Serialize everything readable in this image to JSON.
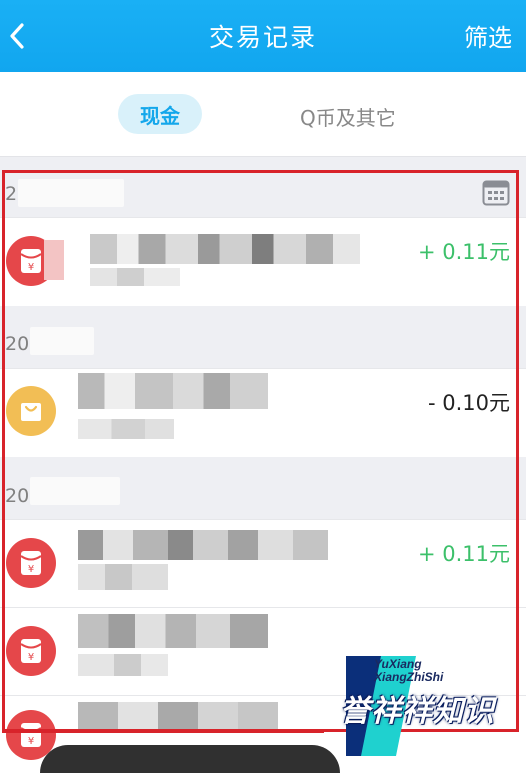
{
  "header": {
    "back_icon": "chevron-left-icon",
    "title": "交易记录",
    "filter_label": "筛选",
    "color": "#14a8ee"
  },
  "tabs": [
    {
      "label": "现金",
      "active": true
    },
    {
      "label": "Q币及其它",
      "active": false
    }
  ],
  "sections": [
    {
      "label": "2",
      "show_calendar": true,
      "calendar_icon": "calendar-icon",
      "records": [
        {
          "icon": "red-envelope-icon",
          "amount": "+ 0.11元",
          "color": "#3cc06a"
        }
      ]
    },
    {
      "label": "20",
      "records": [
        {
          "icon": "shopping-bag-icon",
          "amount": "- 0.10元",
          "color": "#222222"
        }
      ]
    },
    {
      "label": "20",
      "records": [
        {
          "icon": "red-envelope-icon",
          "amount": "+ 0.11元",
          "color": "#3cc06a"
        },
        {
          "icon": "red-envelope-icon",
          "amount": "",
          "color": "#3cc06a"
        },
        {
          "icon": "red-envelope-icon",
          "amount": "",
          "color": "#3cc06a"
        }
      ]
    }
  ],
  "watermark": {
    "line1": "YuXiang",
    "line2": "XiangZhiShi",
    "main": "誉祥祥知识"
  },
  "highlight_color": "#d8232a"
}
